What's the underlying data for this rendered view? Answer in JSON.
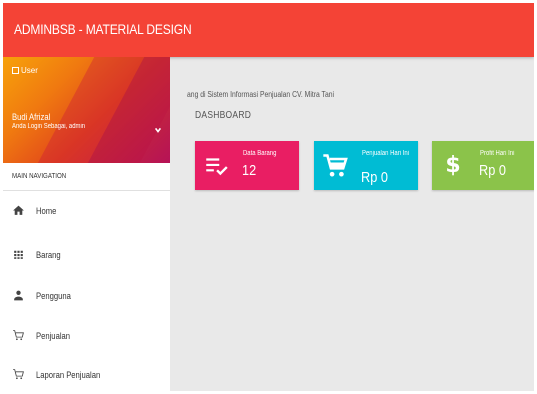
{
  "header": {
    "brand": "ADMINBSB - MATERIAL DESIGN"
  },
  "user": {
    "image_alt": "User",
    "name": "Budi Afrizal",
    "role_text": "Anda Login Sebagai, admin",
    "caret_icon": "chevron-down-icon"
  },
  "sidebar": {
    "header": "MAIN NAVIGATION",
    "items": [
      {
        "label": "Home",
        "icon": "home-icon"
      },
      {
        "label": "Barang",
        "icon": "grid-icon"
      },
      {
        "label": "Pengguna",
        "icon": "person-icon"
      },
      {
        "label": "Penjualan",
        "icon": "cart-icon"
      },
      {
        "label": "Laporan Penjualan",
        "icon": "cart-icon"
      }
    ]
  },
  "main": {
    "welcome": "ang di Sistem Informasi Penjualan CV. Mitra Tani",
    "title": "DASHBOARD"
  },
  "info_boxes": [
    {
      "title": "Data Barang",
      "value": "12",
      "icon": "playlist-check-icon",
      "color": "#e91e63"
    },
    {
      "title": "Penjualan Hari Ini",
      "value": "Rp 0",
      "icon": "shopping-cart-icon",
      "color": "#00bcd4"
    },
    {
      "title": "Profit Hari Ini",
      "value": "Rp 0",
      "icon": "dollar-icon",
      "color": "#8bc34a"
    }
  ],
  "colors": {
    "topbar": "#f44336",
    "sidebar": "#ffffff",
    "content": "#e9e9e9"
  }
}
